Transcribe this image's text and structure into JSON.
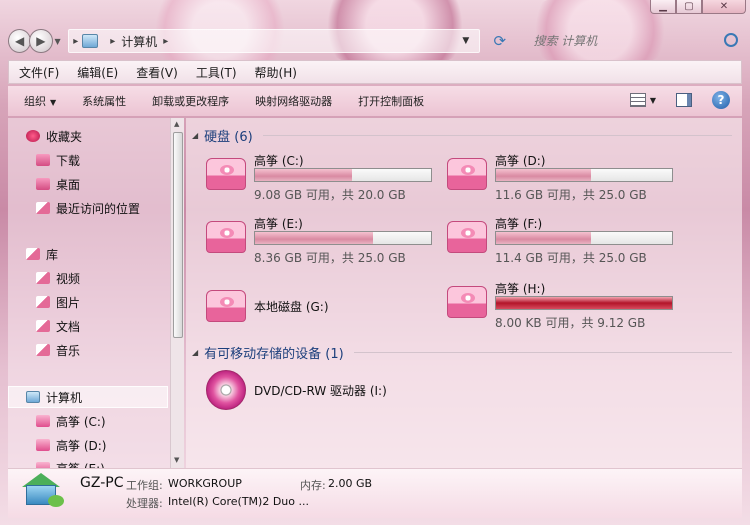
{
  "window": {
    "minimize_glyph": "▁",
    "maximize_glyph": "▢",
    "close_glyph": "✕"
  },
  "address": {
    "location": "计算机",
    "separator": "▸"
  },
  "search": {
    "placeholder": "搜索 计算机"
  },
  "menu": [
    "文件(F)",
    "编辑(E)",
    "查看(V)",
    "工具(T)",
    "帮助(H)"
  ],
  "toolbar": {
    "organize": "组织",
    "system_properties": "系统属性",
    "uninstall": "卸载或更改程序",
    "map_drive": "映射网络驱动器",
    "control_panel": "打开控制面板"
  },
  "sidebar": {
    "favorites": "收藏夹",
    "downloads": "下载",
    "desktop": "桌面",
    "recent": "最近访问的位置",
    "libraries": "库",
    "videos": "视频",
    "pictures": "图片",
    "documents": "文档",
    "music": "音乐",
    "computer": "计算机",
    "drive_c": "高筝 (C:)",
    "drive_d": "高筝 (D:)",
    "drive_e": "高筝 (E:)"
  },
  "content": {
    "hard_disks_header": "硬盘 (6)",
    "removable_header": "有可移动存储的设备 (1)",
    "drives": [
      {
        "name": "高筝 (C:)",
        "free": "9.08 GB 可用，共 20.0 GB",
        "used_fraction": 0.55
      },
      {
        "name": "高筝 (D:)",
        "free": "11.6 GB 可用，共 25.0 GB",
        "used_fraction": 0.54
      },
      {
        "name": "高筝 (E:)",
        "free": "8.36 GB 可用，共 25.0 GB",
        "used_fraction": 0.67
      },
      {
        "name": "高筝 (F:)",
        "free": "11.4 GB 可用，共 25.0 GB",
        "used_fraction": 0.54
      },
      {
        "name": "本地磁盘 (G:)",
        "free": "",
        "used_fraction": null
      },
      {
        "name": "高筝 (H:)",
        "free": "8.00 KB 可用，共 9.12 GB",
        "used_fraction": 1.0
      }
    ],
    "dvd": "DVD/CD-RW 驱动器 (I:)"
  },
  "details": {
    "pc_name": "GZ-PC",
    "workgroup_label": "工作组:",
    "workgroup_value": "WORKGROUP",
    "memory_label": "内存:",
    "memory_value": "2.00 GB",
    "processor_label": "处理器:",
    "processor_value": "Intel(R) Core(TM)2 Duo ..."
  }
}
